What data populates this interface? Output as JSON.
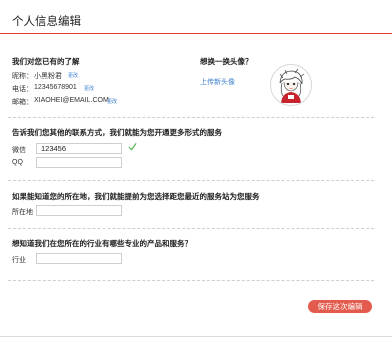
{
  "page": {
    "title": "个人信息编辑"
  },
  "known_info": {
    "heading": "我们对您已有的了解",
    "nickname": {
      "label": "昵称：",
      "value": "小黑粉君",
      "edit": "更改"
    },
    "phone": {
      "label": "电话：",
      "value": "12345678901",
      "edit": "更改"
    },
    "email": {
      "label": "邮箱：",
      "value": "XIAOHEI@EMAIL.COM",
      "edit": "更改"
    }
  },
  "avatar": {
    "heading": "想换一换头像？",
    "upload_label": "上传新头像"
  },
  "contact": {
    "heading": "告诉我们您其他的联系方式，我们就能为您开通更多形式的服务",
    "wechat": {
      "label": "微信",
      "value": "123456",
      "placeholder": ""
    },
    "qq": {
      "label": "QQ",
      "value": "",
      "placeholder": ""
    }
  },
  "location": {
    "heading": "如果能知道您的所在地，我们就能提前为您选择距您最近的服务站为您服务",
    "label": "所在地",
    "value": "",
    "placeholder": ""
  },
  "industry": {
    "heading": "想知道我们在您所在的行业有哪些专业的产品和服务？",
    "label": "行业",
    "value": "",
    "placeholder": ""
  },
  "actions": {
    "save_label": "保存这次编辑"
  },
  "colors": {
    "accent": "#e53935",
    "link": "#3b7fd1",
    "button": "#e25b4d",
    "check": "#5cb85c"
  }
}
